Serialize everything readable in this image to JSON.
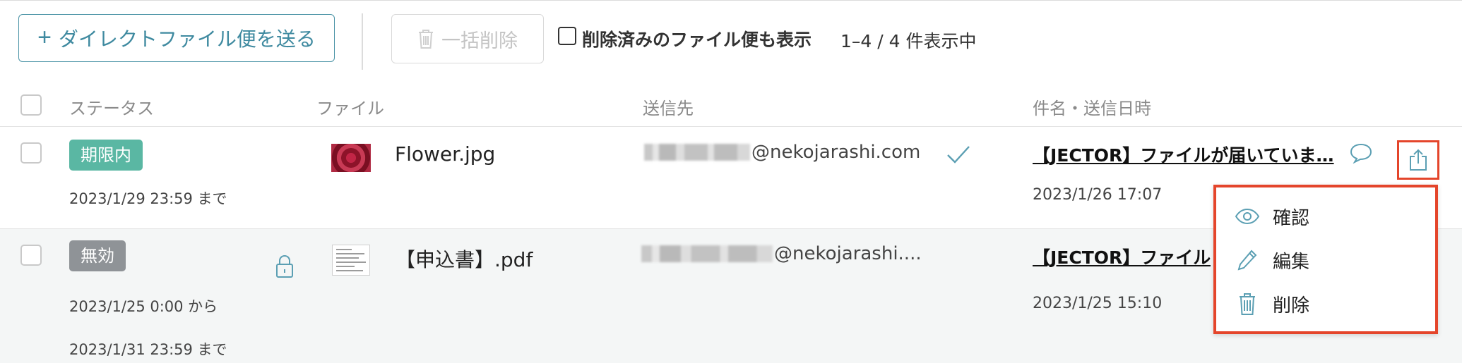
{
  "toolbar": {
    "send_label": "ダイレクトファイル便を送る",
    "bulk_delete_label": "一括削除",
    "show_deleted_label": "削除済みのファイル便も表示",
    "count_label": "1–4 / 4 件表示中"
  },
  "table": {
    "headers": {
      "status": "ステータス",
      "file": "ファイル",
      "recipient": "送信先",
      "subject_date": "件名・送信日時"
    },
    "rows": [
      {
        "status": "期限内",
        "validity": "2023/1/29 23:59 まで",
        "filename": "Flower.jpg",
        "email_domain": "@nekojarashi.com",
        "subject": "【JECTOR】ファイルが届いていま…",
        "sent_at": "2023/1/26 17:07"
      },
      {
        "status": "無効",
        "validity_from": "2023/1/25 0:00 から",
        "validity_to": "2023/1/31 23:59 まで",
        "filename": "【申込書】.pdf",
        "email_domain": "@nekojarashi....",
        "subject": "【JECTOR】ファイル",
        "sent_at": "2023/1/25 15:10"
      }
    ]
  },
  "menu": {
    "items": [
      {
        "label": "確認",
        "icon": "eye-icon"
      },
      {
        "label": "編集",
        "icon": "pencil-icon"
      },
      {
        "label": "削除",
        "icon": "trash-icon"
      }
    ]
  },
  "colors": {
    "accent": "#4a93a6",
    "status_valid": "#5ab7a3",
    "status_invalid": "#8f9397",
    "highlight": "#e4452b"
  }
}
